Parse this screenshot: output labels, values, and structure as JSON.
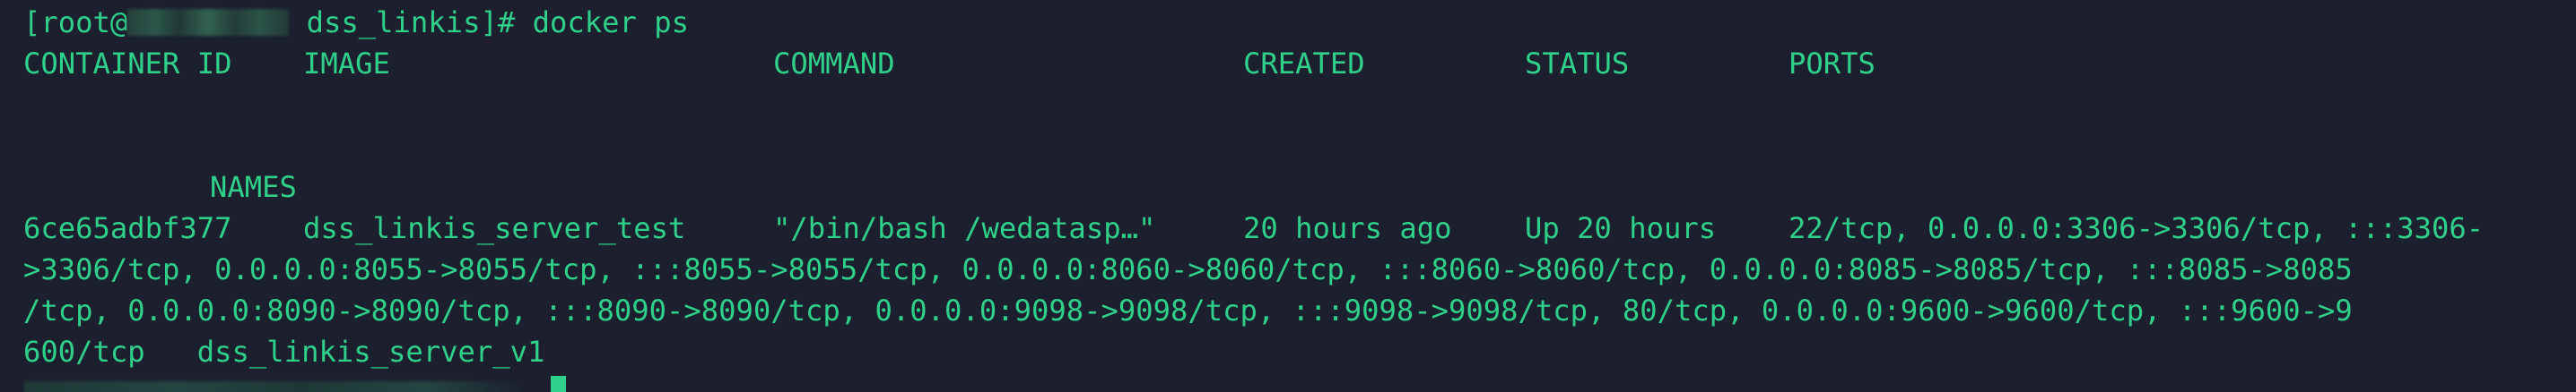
{
  "prompt": {
    "prefix": "[root@",
    "suffix": " dss_linkis]# ",
    "command": "docker ps"
  },
  "headers": {
    "container_id": "CONTAINER ID",
    "image": "IMAGE",
    "command": "COMMAND",
    "created": "CREATED",
    "status": "STATUS",
    "ports": "PORTS",
    "names": "NAMES"
  },
  "row": {
    "container_id": "6ce65adbf377",
    "image": "dss_linkis_server_test",
    "command": "\"/bin/bash /wedatasp…\"",
    "created": "20 hours ago",
    "status": "Up 20 hours",
    "ports_line1": "22/tcp, 0.0.0.0:3306->3306/tcp, :::3306-",
    "ports_line2": ">3306/tcp, 0.0.0.0:8055->8055/tcp, :::8055->8055/tcp, 0.0.0.0:8060->8060/tcp, :::8060->8060/tcp, 0.0.0.0:8085->8085/tcp, :::8085->8085",
    "ports_line3": "/tcp, 0.0.0.0:8090->8090/tcp, :::8090->8090/tcp, 0.0.0.0:9098->9098/tcp, :::9098->9098/tcp, 80/tcp, 0.0.0.0:9600->9600/tcp, :::9600->9",
    "ports_line4": "600/tcp",
    "name": "dss_linkis_server_v1"
  },
  "colors": {
    "background": "#1c1f2e",
    "text": "#2fd18a"
  }
}
